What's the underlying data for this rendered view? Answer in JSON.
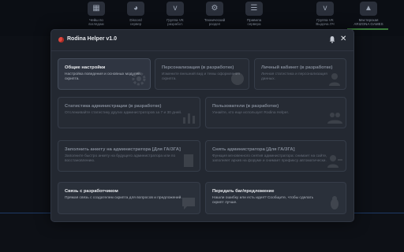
{
  "background": {
    "tiles": [
      {
        "label": "Чейш по\nвзглядам",
        "icon": "chart-icon"
      },
      {
        "label": "Discord\nсервер",
        "icon": "discord-icon"
      },
      {
        "label": "Группа VK\nразработ.",
        "icon": "vk-icon"
      },
      {
        "label": "Технический\nраздел",
        "icon": "gear-icon"
      },
      {
        "label": "Правила\nсервера",
        "icon": "document-icon"
      },
      {
        "label": "Группа VK\nВыдача ЛЧ",
        "icon": "vk-icon"
      },
      {
        "label": "Мастерская\nARIZONA GAMES",
        "icon": "shop-icon"
      }
    ]
  },
  "modal": {
    "title": "Rodina Helper v1.0",
    "cards": [
      {
        "id": "general",
        "title": "Общие настройки",
        "desc": "Настройка поведения и основных модулей скрипта.",
        "state": "active",
        "icon": "gear-icon"
      },
      {
        "id": "personalization",
        "title": "Персонализация (в разработке)",
        "desc": "Измените внешний вид и темы оформления скрипта.",
        "state": "dev",
        "icon": "palette-icon"
      },
      {
        "id": "cabinet",
        "title": "Личный кабинет (в разработке)",
        "desc": "Личная статистика и персонализация данных.",
        "state": "dev",
        "icon": "user-icon"
      },
      {
        "id": "admin-stats",
        "title": "Статистика администрации (в разработке)",
        "desc": "Отслеживайте статистику других администраторов за 7 и 30 дней.",
        "state": "dev",
        "icon": "chart-icon"
      },
      {
        "id": "users",
        "title": "Пользователи (в разработке)",
        "desc": "Узнайте, кто еще использует Rodina Helper.",
        "state": "dev",
        "icon": "users-icon"
      },
      {
        "id": "fill-form",
        "title": "Заполнить анкету на администратора [Для ГА/ЗГА]",
        "desc": "Заполните быстро анкету на будущего администратора или по восстановлению.",
        "state": "dev",
        "icon": "form-icon"
      },
      {
        "id": "remove-admin",
        "title": "Снять администратора [Для ГА/ЗГА]",
        "desc": "Функция мгновенного снятия администратора: снимает на сайте, заполняет архив на форуме и снимает префиксу автоматически.",
        "state": "dev",
        "icon": "remove-user-icon"
      },
      {
        "id": "contact-dev",
        "title": "Связь с разработчиком",
        "desc": "Прямая связь с создателем скрипта для вопросов и предложений.",
        "state": "normal",
        "icon": "chat-icon"
      },
      {
        "id": "report-bug",
        "title": "Передать баг/предложение",
        "desc": "Нашли ошибку или есть идея? Сообщите, чтобы сделать скрипт лучше.",
        "state": "normal",
        "icon": "bug-icon"
      }
    ]
  }
}
